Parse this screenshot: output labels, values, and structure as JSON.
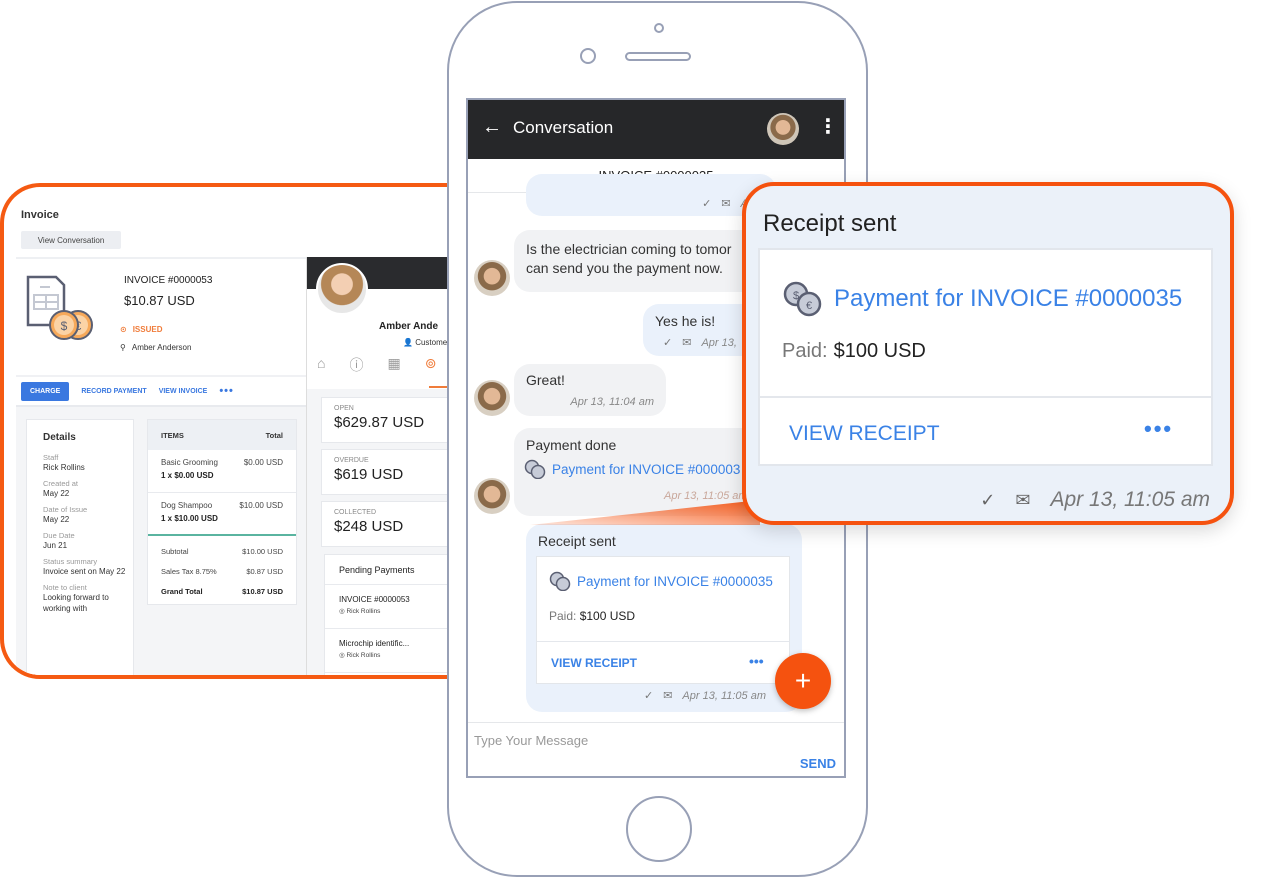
{
  "invoice_panel": {
    "title": "Invoice",
    "view_conversation_label": "View Conversation",
    "invoice_number": "INVOICE #0000053",
    "amount": "$10.87 USD",
    "status": "ISSUED",
    "client": "Amber Anderson",
    "actions": {
      "charge": "CHARGE",
      "record_payment": "RECORD PAYMENT",
      "view_invoice": "VIEW INVOICE",
      "more": "•••"
    },
    "details": {
      "heading": "Details",
      "fields": [
        {
          "label": "Staff",
          "value": "Rick Rollins"
        },
        {
          "label": "Created at",
          "value": "May 22"
        },
        {
          "label": "Date of Issue",
          "value": "May 22"
        },
        {
          "label": "Due Date",
          "value": "Jun 21"
        },
        {
          "label": "Status summary",
          "value": "Invoice sent on May 22"
        },
        {
          "label": "Note to client",
          "value": "Looking forward to working with"
        }
      ]
    },
    "items_table": {
      "headers": [
        "ITEMS",
        "Total"
      ],
      "rows": [
        {
          "name": "Basic Grooming",
          "qty": "1 x $0.00 USD",
          "total": "$0.00 USD"
        },
        {
          "name": "Dog Shampoo",
          "qty": "1 x $10.00 USD",
          "total": "$10.00 USD"
        }
      ],
      "subtotal_label": "Subtotal",
      "subtotal": "$10.00 USD",
      "tax_label": "Sales Tax 8.75%",
      "tax": "$0.87 USD",
      "grand_total_label": "Grand Total",
      "grand_total": "$10.87 USD"
    }
  },
  "customer_panel": {
    "name": "Amber Ande",
    "role": "Custome",
    "tabs": [
      "home-icon",
      "info-icon",
      "calendar-icon",
      "payments-icon"
    ],
    "stats": [
      {
        "label": "OPEN",
        "value": "$629.87 USD"
      },
      {
        "label": "OVERDUE",
        "value": "$619 USD"
      },
      {
        "label": "COLLECTED",
        "value": "$248 USD"
      }
    ],
    "pending": {
      "heading": "Pending Payments",
      "items": [
        {
          "title": "INVOICE #0000053",
          "staff": "Rick Rollins"
        },
        {
          "title": "Microchip identific...",
          "staff": "Rick Rollins"
        }
      ]
    }
  },
  "phone": {
    "appbar_title": "Conversation",
    "invoice_strip": "INVOICE #0000035",
    "messages": {
      "m0_time": "Apr 13,",
      "m1_text": "Is the electrician coming to tomor can send you the payment now.",
      "m1_line1": "Is the electrician coming to tomor",
      "m1_line2": "can send you the payment now.",
      "m2_text": "Yes he is!",
      "m2_time": "Apr 13,",
      "m3_text": "Great!",
      "m3_time": "Apr 13, 11:04 am",
      "m4_title": "Payment done",
      "m4_link": "Payment for INVOICE #000003",
      "m4_time": "Apr 13, 11:05 am",
      "m5_title": "Receipt sent",
      "m5_link": "Payment for INVOICE #0000035",
      "m5_paid_label": "Paid:",
      "m5_paid_value": "$100 USD",
      "m5_view": "VIEW RECEIPT",
      "m5_more": "•••",
      "m5_time": "Apr 13, 11:05 am"
    },
    "fab_label": "+",
    "input_placeholder": "Type Your Message",
    "send_label": "SEND"
  },
  "callout": {
    "title": "Receipt sent",
    "link": "Payment for INVOICE #0000035",
    "paid_label": "Paid:",
    "paid_value": "$100 USD",
    "view_receipt": "VIEW RECEIPT",
    "more": "•••",
    "timestamp": "Apr 13, 11:05 am"
  },
  "colors": {
    "accent_orange": "#f5520f",
    "link_blue": "#3a82e6",
    "appbar_dark": "#262729",
    "status_issued": "#f07c3a"
  }
}
